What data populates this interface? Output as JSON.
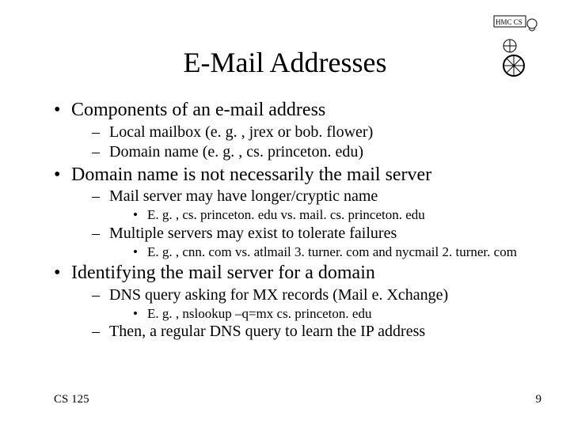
{
  "title": "E-Mail Addresses",
  "logo": {
    "name": "hmc-cs-logo"
  },
  "bullets": [
    {
      "text": "Components of an e-mail address",
      "sub": [
        {
          "text": "Local mailbox (e. g. , jrex or bob. flower)"
        },
        {
          "text": "Domain name (e. g. , cs. princeton. edu)"
        }
      ]
    },
    {
      "text": "Domain name is not necessarily the mail server",
      "sub": [
        {
          "text": "Mail server may have longer/cryptic name",
          "sub": [
            {
              "text": "E. g. , cs. princeton. edu vs. mail. cs. princeton. edu"
            }
          ]
        },
        {
          "text": "Multiple servers may exist to tolerate failures",
          "sub": [
            {
              "text": "E. g. , cnn. com vs. atlmail 3. turner. com and nycmail 2. turner. com"
            }
          ]
        }
      ]
    },
    {
      "text": "Identifying the mail server for a domain",
      "sub": [
        {
          "text": "DNS query asking for MX records (Mail e. Xchange)",
          "sub": [
            {
              "text": "E. g. , nslookup –q=mx cs. princeton. edu"
            }
          ]
        },
        {
          "text": "Then, a regular DNS query to learn the IP address"
        }
      ]
    }
  ],
  "footer": {
    "left": "CS 125",
    "right": "9"
  }
}
